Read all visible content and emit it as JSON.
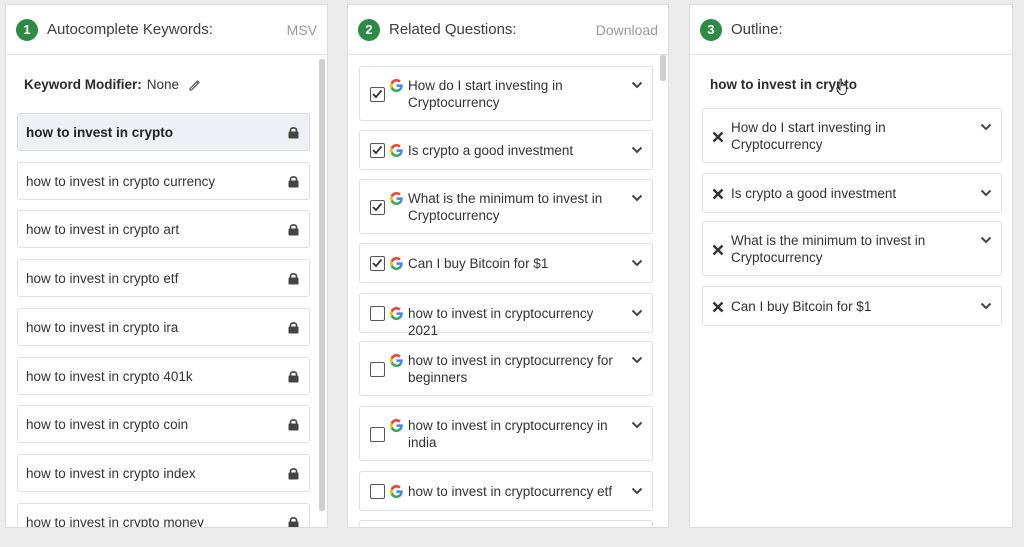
{
  "panel1": {
    "number": "1",
    "title": "Autocomplete Keywords:",
    "action": "MSV",
    "modifier_label": "Keyword Modifier:",
    "modifier_value": "None",
    "keywords": [
      "how to invest in crypto",
      "how to invest in crypto currency",
      "how to invest in crypto art",
      "how to invest in crypto etf",
      "how to invest in crypto ira",
      "how to invest in crypto 401k",
      "how to invest in crypto coin",
      "how to invest in crypto index",
      "how to invest in crypto money"
    ]
  },
  "panel2": {
    "number": "2",
    "title": "Related Questions:",
    "action": "Download",
    "questions": [
      {
        "text": "How do I start investing in Cryptocurrency",
        "checked": true
      },
      {
        "text": "Is crypto a good investment",
        "checked": true
      },
      {
        "text": "What is the minimum to invest in Cryptocurrency",
        "checked": true
      },
      {
        "text": "Can I buy Bitcoin for $1",
        "checked": true
      },
      {
        "text": "how to invest in cryptocurrency 2021",
        "checked": false
      },
      {
        "text": "how to invest in cryptocurrency for beginners",
        "checked": false
      },
      {
        "text": "how to invest in cryptocurrency in india",
        "checked": false
      },
      {
        "text": "how to invest in cryptocurrency etf",
        "checked": false
      }
    ]
  },
  "panel3": {
    "number": "3",
    "title": "Outline:",
    "outline_title": "how to invest in crypto",
    "items": [
      "How do I start investing in Cryptocurrency",
      "Is crypto a good investment",
      "What is the minimum to invest in Cryptocurrency",
      "Can I buy Bitcoin for $1"
    ]
  },
  "colors": {
    "badge": "#2e8b45",
    "active_row": "#eef0f6"
  }
}
